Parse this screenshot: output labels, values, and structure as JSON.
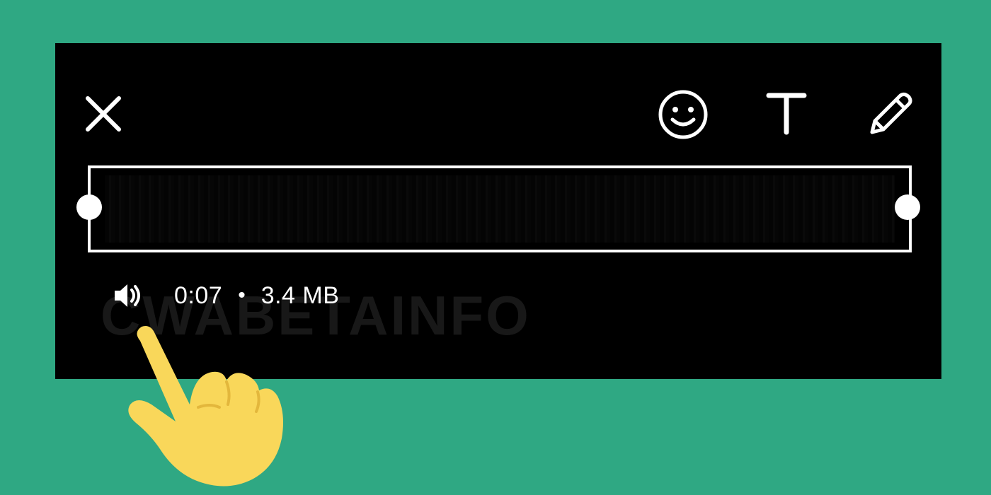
{
  "toolbar": {
    "close_icon": "close-icon",
    "emoji_icon": "emoji-icon",
    "text_icon": "text-icon",
    "draw_icon": "pencil-icon"
  },
  "media": {
    "duration": "0:07",
    "separator": "•",
    "size": "3.4 MB",
    "sound_icon": "speaker-icon"
  },
  "watermark": "CWABETAINFO",
  "colors": {
    "background": "#2fa883",
    "panel": "#000000",
    "foreground": "#ffffff",
    "hand": "#f9d75a"
  }
}
